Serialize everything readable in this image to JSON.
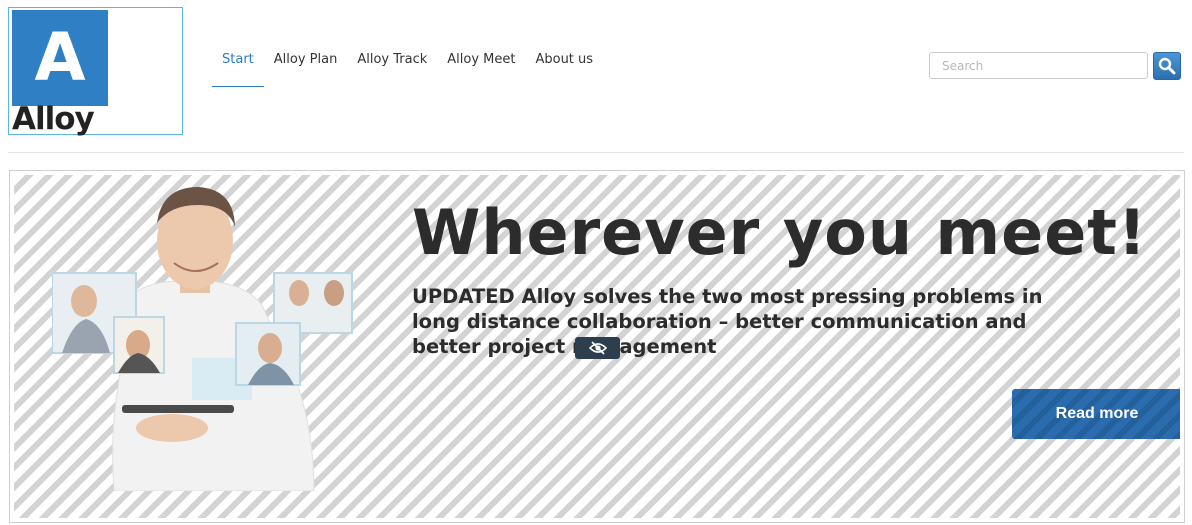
{
  "logo": {
    "letter": "A",
    "word": "Alloy"
  },
  "nav": {
    "items": [
      {
        "label": "Start",
        "active": true
      },
      {
        "label": "Alloy Plan"
      },
      {
        "label": "Alloy Track"
      },
      {
        "label": "Alloy Meet"
      },
      {
        "label": "About us"
      }
    ]
  },
  "search": {
    "placeholder": "Search",
    "icon": "search-icon"
  },
  "hero": {
    "title": "Wherever you meet!",
    "text": "UPDATED Alloy solves the two most pressing problems in long distance collaboration – better communication and better project management",
    "overlay_icon": "eye-off-icon",
    "button_label": "Read more"
  },
  "colors": {
    "accent": "#2d7cc2",
    "logo_blue": "#2f7fc4",
    "button_blue": "#2a6cae",
    "badge_dark": "#2d3e4e"
  }
}
